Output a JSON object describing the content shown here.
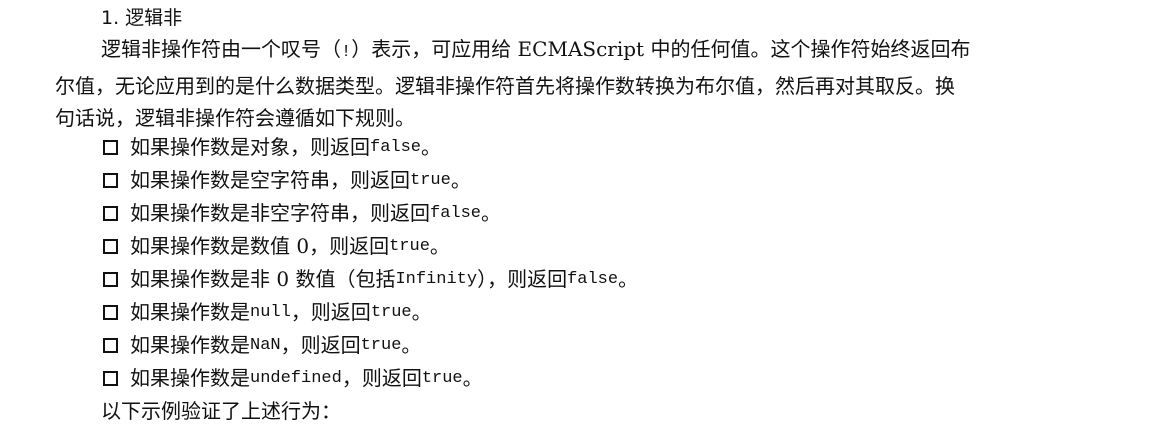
{
  "heading": "1. 逻辑非",
  "intro": {
    "line1_a": "逻辑非操作符由一个叹号（",
    "line1_code": "!",
    "line1_b": "）表示，可应用给 ECMAScript 中的任何值。这个操作符始终返回布",
    "line2": "尔值，无论应用到的是什么数据类型。逻辑非操作符首先将操作数转换为布尔值，然后再对其取反。换",
    "line3": "句话说，逻辑非操作符会遵循如下规则。"
  },
  "rules": [
    {
      "before": "如果操作数是对象，则返回 ",
      "code": "false",
      "after": "。"
    },
    {
      "before": "如果操作数是空字符串，则返回 ",
      "code": "true",
      "after": "。"
    },
    {
      "before": "如果操作数是非空字符串，则返回 ",
      "code": "false",
      "after": "。"
    },
    {
      "before": "如果操作数是数值 0，则返回 ",
      "code": "true",
      "after": "。"
    },
    {
      "before": "如果操作数是非 0 数值（包括 ",
      "code": "Infinity",
      "middle": "），则返回 ",
      "code2": "false",
      "after": "。"
    },
    {
      "before": "如果操作数是 ",
      "code": "null",
      "middle": "，则返回 ",
      "code2": "true",
      "after": "。"
    },
    {
      "before": "如果操作数是 ",
      "code": "NaN",
      "middle": "，则返回 ",
      "code2": "true",
      "after": "。"
    },
    {
      "before": "如果操作数是 ",
      "code": "undefined",
      "middle": "，则返回 ",
      "code2": "true",
      "after": "。"
    }
  ],
  "footer": "以下示例验证了上述行为："
}
